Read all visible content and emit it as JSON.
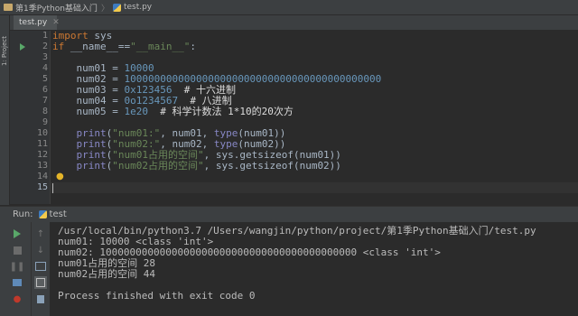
{
  "breadcrumb": {
    "folder": "第1季Python基础入门",
    "file": "test.py"
  },
  "sidebar": {
    "project_label": "1: Project"
  },
  "editor": {
    "tab": {
      "label": "test.py"
    },
    "line_numbers": [
      "1",
      "2",
      "3",
      "4",
      "5",
      "6",
      "7",
      "8",
      "9",
      "10",
      "11",
      "12",
      "13",
      "14",
      "15"
    ],
    "lines": [
      "import sys",
      "if __name__==\"__main__\":",
      "",
      "    num01 = 10000",
      "    num02 = 1000000000000000000000000000000000000000000",
      "    num03 = 0x123456  # 十六进制",
      "    num04 = 0o1234567  # 八进制",
      "    num05 = 1e20  # 科学计数法 1*10的20次方",
      "",
      "    print(\"num01:\", num01, type(num01))",
      "    print(\"num02:\", num02, type(num02))",
      "    print(\"num01占用的空间\", sys.getsizeof(num01))",
      "    print(\"num02占用的空间\", sys.getsizeof(num02))",
      "",
      ""
    ]
  },
  "run_panel": {
    "label": "Run:",
    "tab_label": "test",
    "output": [
      "/usr/local/bin/python3.7 /Users/wangjin/python/project/第1季Python基础入门/test.py",
      "num01: 10000 <class 'int'>",
      "num02: 1000000000000000000000000000000000000000000 <class 'int'>",
      "num01占用的空间 28",
      "num02占用的空间 44",
      "",
      "Process finished with exit code 0"
    ]
  },
  "icons": [
    "folder-icon",
    "python-file-icon",
    "run-icon",
    "stop-icon",
    "pause-icon",
    "up-arrow-icon",
    "down-arrow-icon",
    "soft-wrap-icon",
    "settings-icon",
    "print-icon",
    "pin-icon",
    "trash-icon",
    "lightbulb-icon",
    "close-icon"
  ],
  "colors": {
    "keyword": "#cc7832",
    "number": "#6897bb",
    "string": "#6a8759",
    "builtin": "#8888c6",
    "run_green": "#59a869"
  }
}
